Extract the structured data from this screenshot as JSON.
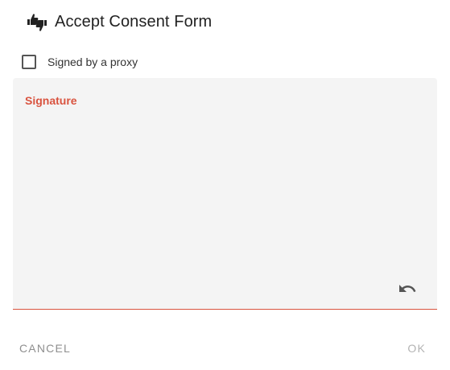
{
  "dialog": {
    "title": "Accept Consent Form",
    "title_icon": "thumbs-up-down-icon"
  },
  "proxy": {
    "label": "Signed by a proxy",
    "checked": false
  },
  "signature": {
    "label": "Signature",
    "label_color": "#d9533f",
    "undo_icon": "undo-icon"
  },
  "actions": {
    "cancel_label": "CANCEL",
    "ok_label": "OK",
    "ok_enabled": false
  }
}
